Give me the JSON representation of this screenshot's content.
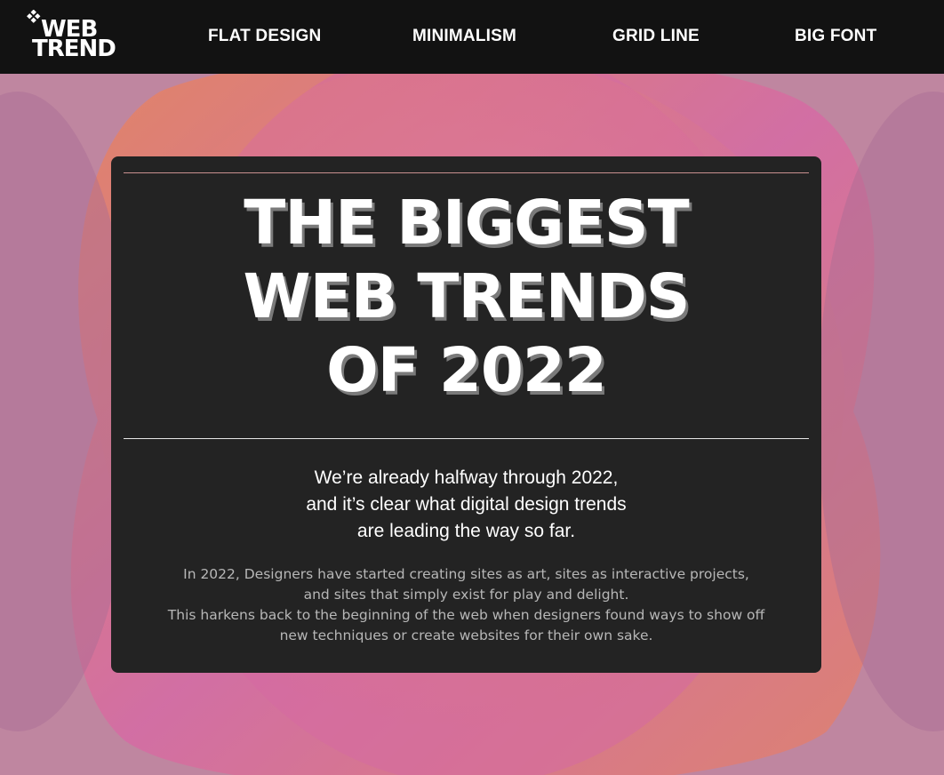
{
  "logo": {
    "line1": "WEB",
    "line2": "TREND",
    "icon": "diamond-cluster-icon"
  },
  "nav": {
    "items": [
      {
        "label": "FLAT DESIGN"
      },
      {
        "label": "MINIMALISM"
      },
      {
        "label": "GRID LINE"
      },
      {
        "label": "BIG FONT"
      }
    ]
  },
  "hero": {
    "headline": [
      "THE BIGGEST",
      "WEB TRENDS",
      "OF 2022"
    ],
    "subhead": [
      "We’re already halfway through 2022,",
      "and it’s clear what digital design trends",
      "are leading the way so far."
    ],
    "body": [
      "In 2022, Designers have started creating sites as art, sites as interactive projects,",
      "and sites that simply exist for play and delight.",
      "This harkens back to the beginning of the web when designers found ways to show off",
      "new techniques or create websites for their own sake."
    ]
  },
  "colors": {
    "header_bg": "#121212",
    "card_bg": "#232323",
    "accent_pink": "#d6689f",
    "accent_orange": "#e07a63"
  }
}
